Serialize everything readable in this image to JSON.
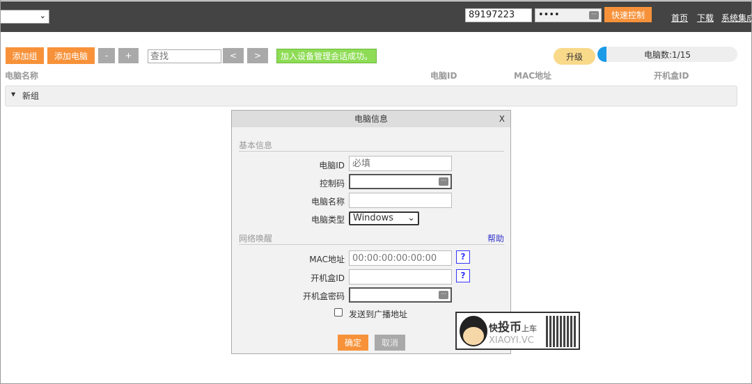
{
  "header": {
    "select_value": "",
    "user_id": "89197223",
    "password_mask": "••••",
    "quick_control": "快速控制",
    "links": [
      "首页",
      "下载",
      "系统集成"
    ]
  },
  "toolbar": {
    "add_group": "添加组",
    "add_computer": "添加电脑",
    "minus": "-",
    "plus": "+",
    "search_placeholder": "查找",
    "prev": "<",
    "next": ">",
    "status": "加入设备管理会话成功。",
    "upgrade": "升级",
    "count_label": "电脑数:1/15",
    "count_fraction": 0.0667
  },
  "columns": [
    "电脑名称",
    "电脑ID",
    "MAC地址",
    "开机盒ID"
  ],
  "groups": [
    {
      "name": "新组"
    }
  ],
  "dialog": {
    "title": "电脑信息",
    "close": "X",
    "basic_section": "基本信息",
    "computer_id_label": "电脑ID",
    "computer_id_placeholder": "必填",
    "control_code_label": "控制码",
    "computer_name_label": "电脑名称",
    "computer_type_label": "电脑类型",
    "computer_type_value": "Windows",
    "wol_section": "网络唤醒",
    "help": "帮助",
    "mac_label": "MAC地址",
    "mac_placeholder": "00:00:00:00:00:00",
    "box_id_label": "开机盒ID",
    "box_pw_label": "开机盒密码",
    "q": "?",
    "broadcast_label": "发送到广播地址",
    "ok": "确定",
    "cancel": "取消"
  },
  "watermark": {
    "line1a": "快",
    "line1b": "投币",
    "line1c": "上车",
    "line2": "XIAOYI.VC"
  }
}
